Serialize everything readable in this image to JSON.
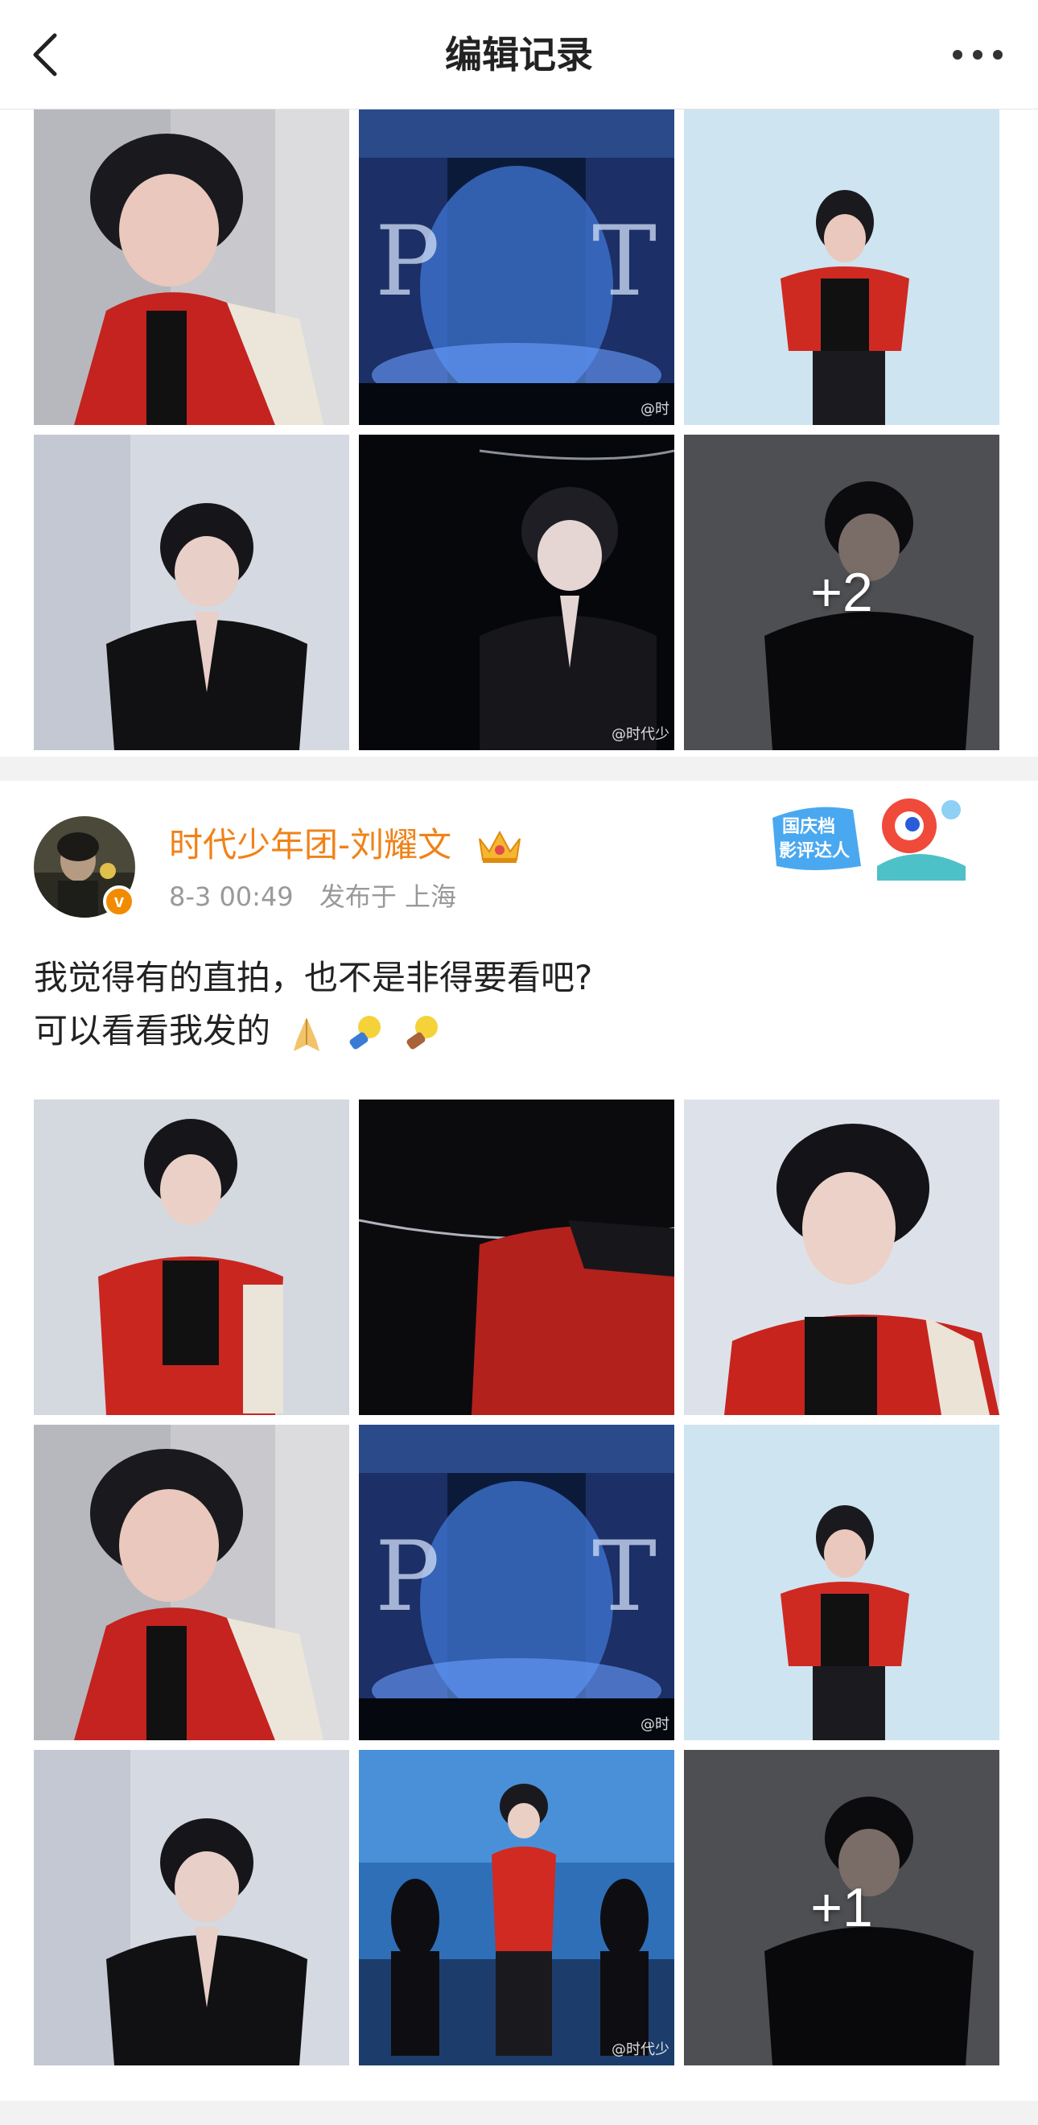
{
  "header": {
    "title": "编辑记录",
    "back_icon": "back-chevron-icon",
    "more_icon": "more-dots-icon"
  },
  "post1": {
    "images_more": "+2",
    "watermark_a": "@时",
    "watermark_b": "@时代少"
  },
  "post2": {
    "author": "时代少年团-刘耀文",
    "date": "8-3 00:49",
    "location": "发布于 上海",
    "tag_text_1": "国庆档",
    "tag_text_2": "影评达人",
    "text_line1": "我觉得有的直拍，也不是非得要看吧?",
    "text_line2": "可以看看我发的",
    "images_more": "+1",
    "watermark_a": "@时",
    "watermark_b": "@时代少"
  },
  "colors": {
    "accent": "#f08218",
    "meta": "#999999",
    "background": "#f2f2f2"
  }
}
